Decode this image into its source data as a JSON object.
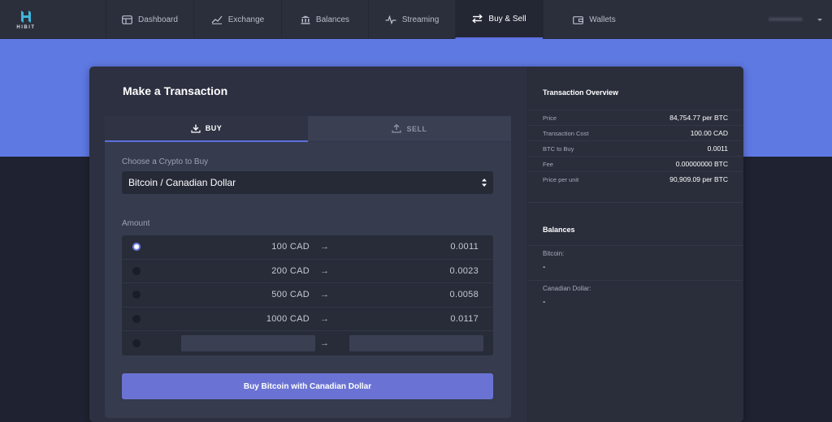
{
  "logo": {
    "wordmark": "HIBIT"
  },
  "nav": {
    "tabs": [
      {
        "label": "Dashboard",
        "icon": "dashboard-icon"
      },
      {
        "label": "Exchange",
        "icon": "chart-line-icon"
      },
      {
        "label": "Balances",
        "icon": "bank-icon"
      },
      {
        "label": "Streaming",
        "icon": "pulse-icon"
      },
      {
        "label": "Buy & Sell",
        "icon": "swap-arrows-icon",
        "active": true
      },
      {
        "label": "Wallets",
        "icon": "wallet-icon"
      }
    ]
  },
  "user": {
    "name": "••••••••••"
  },
  "transaction": {
    "title": "Make a Transaction",
    "tabs": {
      "buy": "BUY",
      "sell": "SELL"
    },
    "crypto_label": "Choose a Crypto to Buy",
    "crypto_selected": "Bitcoin / Canadian Dollar",
    "amount_label": "Amount",
    "amounts": [
      {
        "cad": "100 CAD",
        "btc": "0.0011",
        "selected": true
      },
      {
        "cad": "200 CAD",
        "btc": "0.0023"
      },
      {
        "cad": "500 CAD",
        "btc": "0.0058"
      },
      {
        "cad": "1000 CAD",
        "btc": "0.0117"
      }
    ],
    "arrow": "→",
    "submit_label": "Buy Bitcoin with Canadian Dollar"
  },
  "overview": {
    "title": "Transaction Overview",
    "rows": [
      {
        "key": "Price",
        "value": "84,754.77 per BTC"
      },
      {
        "key": "Transaction Cost",
        "value": "100.00 CAD"
      },
      {
        "key": "BTC to Buy",
        "value": "0.0011"
      },
      {
        "key": "Fee",
        "value": "0.00000000 BTC"
      },
      {
        "key": "Price per unit",
        "value": "90,909.09 per BTC"
      }
    ]
  },
  "balances": {
    "title": "Balances",
    "bitcoin_label": "Bitcoin:",
    "bitcoin_value": "-",
    "cad_label": "Canadian Dollar:",
    "cad_value": "-"
  },
  "colors": {
    "accent": "#5d6ee0",
    "band": "#5f79e3",
    "button": "#6a73d3",
    "background": "#1f2230",
    "card": "#2c3040"
  }
}
